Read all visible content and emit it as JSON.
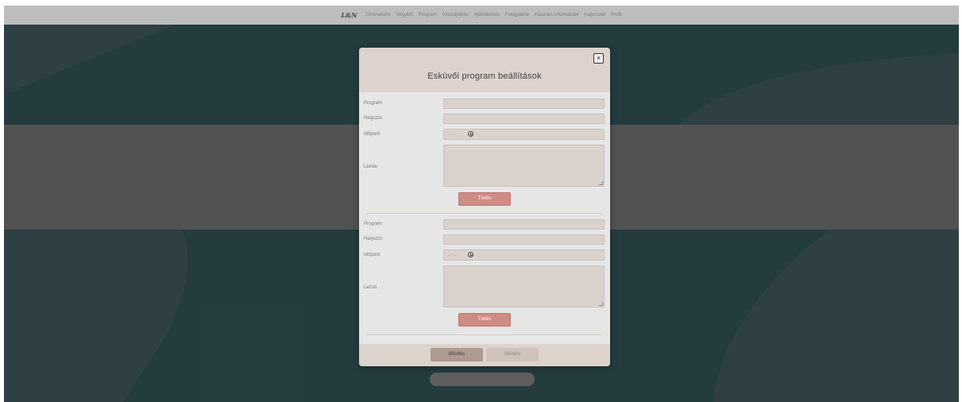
{
  "navbar": {
    "logo": "L&N",
    "items": [
      "Történetünk",
      "Vegyklő",
      "Program",
      "Visszajelzés",
      "Ajándéklista",
      "Fotógaléria",
      "Hasznos információk",
      "Kapcsolat",
      "Profil"
    ]
  },
  "modal": {
    "title": "Esküvői program beállítások",
    "close_symbol": "×",
    "labels": {
      "program": "Program",
      "location": "Helyszín",
      "time": "Időpont",
      "description": "Leírás"
    },
    "entries": [
      {
        "program": "",
        "location": "",
        "time": "--:-- ",
        "description": "",
        "delete_label": "Törlés"
      },
      {
        "program": "",
        "location": "",
        "time": "--:-- ",
        "description": "",
        "delete_label": "Törlés"
      }
    ],
    "footer": {
      "add_label": "Bővítés",
      "save_label": "Mentés"
    }
  },
  "colors": {
    "background_teal": "#2f4e50",
    "background_shape": "#3c5356",
    "band_gray": "#6a6a6a",
    "modal_header": "#ddd3cc",
    "delete_button": "#cf8c85",
    "add_button": "#ad9a90",
    "save_button": "#cfc2ba"
  },
  "icons": [
    "close-icon",
    "clock-icon",
    "resize-grip-icon"
  ]
}
